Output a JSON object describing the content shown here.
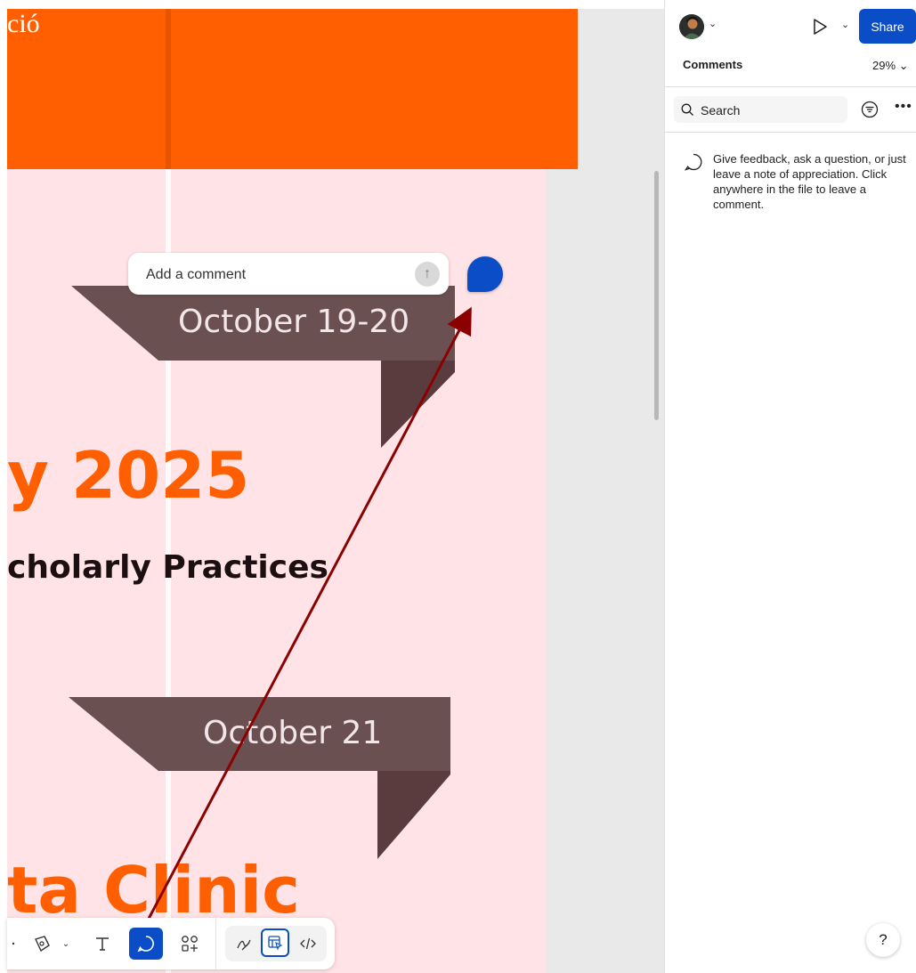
{
  "canvas": {
    "banner_text": "ció",
    "date_1": "October 19-20",
    "date_2": "October 21",
    "heading_year": "y 2025",
    "heading_sub": "cholarly Practices",
    "heading_clinic": "ta Clinic",
    "colors": {
      "orange": "#ff5f00",
      "pink": "#ffe3e6",
      "ribbon": "#6b5052",
      "ribbon_dark": "#5a3c3f"
    }
  },
  "comment_composer": {
    "placeholder": "Add a comment",
    "send_icon": "arrow-up-icon",
    "pin_icon": "comment-pin-icon"
  },
  "toolbar": {
    "tools": [
      "chevron-down-icon",
      "pen-icon",
      "text-icon",
      "comment-icon",
      "shapes-icon",
      "draw-icon",
      "inspect-icon",
      "code-icon"
    ],
    "active_tool": "comment-icon",
    "accent": "#0b4dc7"
  },
  "panel": {
    "share_label": "Share",
    "comments_tab": "Comments",
    "zoom": "29%",
    "search_placeholder": "Search",
    "empty_message": "Give feedback, ask a question, or just leave a note of appreciation. Click anywhere in the file to leave a comment.",
    "help_label": "?"
  }
}
